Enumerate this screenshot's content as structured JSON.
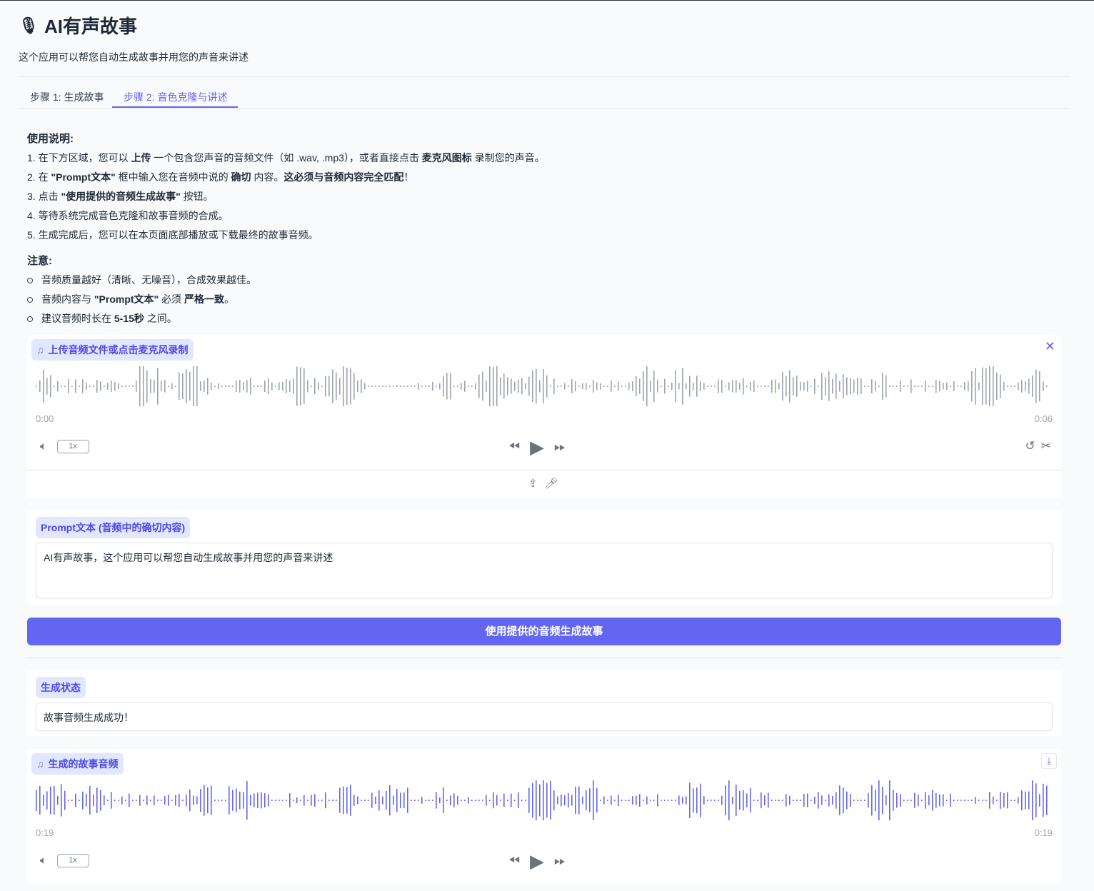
{
  "header": {
    "title": "AI有声故事",
    "subtitle": "这个应用可以帮您自动生成故事并用您的声音来讲述"
  },
  "tabs": [
    {
      "label": "步骤 1: 生成故事",
      "active": false
    },
    {
      "label": "步骤 2: 音色克隆与讲述",
      "active": true
    }
  ],
  "instructions": {
    "title": "使用说明:",
    "steps": [
      [
        "1. 在下方区域，您可以 ",
        {
          "b": "上传"
        },
        " 一个包含您声音的音频文件（如 .wav, .mp3），或者直接点击 ",
        {
          "b": "麦克风图标"
        },
        " 录制您的声音。"
      ],
      [
        "2. 在 ",
        {
          "b": "\"Prompt文本\""
        },
        " 框中输入您在音频中说的 ",
        {
          "b": "确切"
        },
        " 内容。",
        {
          "b": "这必须与音频内容完全匹配"
        },
        "！"
      ],
      [
        "3. 点击 ",
        {
          "b": "\"使用提供的音频生成故事\""
        },
        " 按钮。"
      ],
      [
        "4. 等待系统完成音色克隆和故事音频的合成。"
      ],
      [
        "5. 生成完成后，您可以在本页面底部播放或下载最终的故事音频。"
      ]
    ],
    "notes_title": "注意:",
    "notes": [
      [
        "音频质量越好（清晰、无噪音），合成效果越佳。"
      ],
      [
        "音频内容与 ",
        {
          "b": "\"Prompt文本\""
        },
        " 必须 ",
        {
          "b": "严格一致"
        },
        "。"
      ],
      [
        "建议音频时长在 ",
        {
          "b": "5-15秒"
        },
        " 之间。"
      ]
    ]
  },
  "upload_audio": {
    "label": "上传音频文件或点击麦克风录制",
    "time_start": "0:00",
    "time_end": "0:06",
    "speed": "1x",
    "wave_color": "#9ca3af"
  },
  "prompt": {
    "label": "Prompt文本 (音频中的确切内容)",
    "value": "AI有声故事，这个应用可以帮您自动生成故事并用您的声音来讲述"
  },
  "generate_button": {
    "label": "使用提供的音频生成故事"
  },
  "status": {
    "label": "生成状态",
    "value": "故事音频生成成功！"
  },
  "output_audio": {
    "label": "生成的故事音频",
    "time_start": "0:19",
    "time_end": "0:19",
    "speed": "1x",
    "wave_color": "#6366f1"
  },
  "colors": {
    "accent": "#6366f1",
    "label_bg": "#e0e7ff"
  }
}
